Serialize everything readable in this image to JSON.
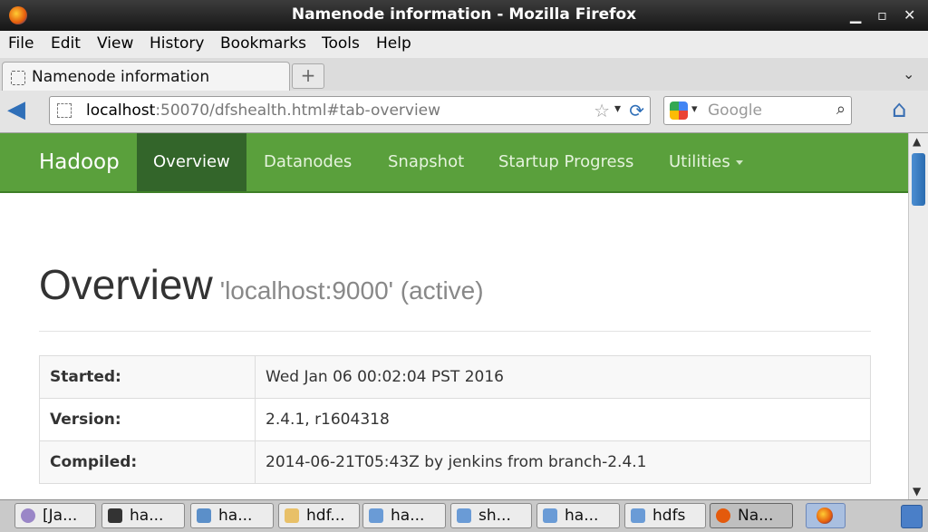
{
  "window": {
    "title": "Namenode information - Mozilla Firefox",
    "min": "▁",
    "max": "▫",
    "close": "✕"
  },
  "menu": [
    "File",
    "Edit",
    "View",
    "History",
    "Bookmarks",
    "Tools",
    "Help"
  ],
  "tab": {
    "label": "Namenode information",
    "new_tab": "+",
    "list": "⌄"
  },
  "address": {
    "host": "localhost",
    "rest": ":50070/dfshealth.html#tab-overview"
  },
  "search": {
    "placeholder": "Google"
  },
  "hadoop_nav": {
    "brand": "Hadoop",
    "items": [
      "Overview",
      "Datanodes",
      "Snapshot",
      "Startup Progress",
      "Utilities"
    ]
  },
  "page": {
    "title": "Overview",
    "subtitle": "'localhost:9000' (active)",
    "rows": [
      {
        "key": "Started:",
        "value": "Wed Jan 06 00:02:04 PST 2016"
      },
      {
        "key": "Version:",
        "value": "2.4.1, r1604318"
      },
      {
        "key": "Compiled:",
        "value": "2014-06-21T05:43Z by jenkins from branch-2.4.1"
      }
    ]
  },
  "taskbar": {
    "items": [
      {
        "label": "[Ja...",
        "icon_color": "#9a86c7"
      },
      {
        "label": "ha...",
        "icon_color": "#333333"
      },
      {
        "label": "ha...",
        "icon_color": "#5b8fc9"
      },
      {
        "label": "hdf...",
        "icon_color": "#e8c068"
      },
      {
        "label": "ha...",
        "icon_color": "#6a9bd6"
      },
      {
        "label": "sh...",
        "icon_color": "#6a9bd6"
      },
      {
        "label": "ha...",
        "icon_color": "#6a9bd6"
      },
      {
        "label": "hdfs",
        "icon_color": "#6a9bd6"
      },
      {
        "label": "Na...",
        "icon_color": "#e45a0c"
      }
    ]
  }
}
